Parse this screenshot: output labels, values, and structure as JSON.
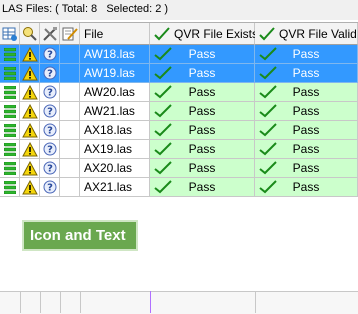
{
  "header": {
    "text": "LAS Files: ( Total: 8   Selected: 2 )"
  },
  "columns": {
    "file": "File",
    "qvr_exists": "QVR File Exists",
    "qvr_valid": "QVR File Valid"
  },
  "rows": [
    {
      "file": "AW18.las",
      "exists": "Pass",
      "valid": "Pass",
      "selected": true
    },
    {
      "file": "AW19.las",
      "exists": "Pass",
      "valid": "Pass",
      "selected": true
    },
    {
      "file": "AW20.las",
      "exists": "Pass",
      "valid": "Pass",
      "selected": false
    },
    {
      "file": "AW21.las",
      "exists": "Pass",
      "valid": "Pass",
      "selected": false
    },
    {
      "file": "AX18.las",
      "exists": "Pass",
      "valid": "Pass",
      "selected": false
    },
    {
      "file": "AX19.las",
      "exists": "Pass",
      "valid": "Pass",
      "selected": false
    },
    {
      "file": "AX20.las",
      "exists": "Pass",
      "valid": "Pass",
      "selected": false
    },
    {
      "file": "AX21.las",
      "exists": "Pass",
      "valid": "Pass",
      "selected": false
    }
  ],
  "header_icons": [
    "table-import-icon",
    "search-warning-icon",
    "tools-icon",
    "edit-note-icon"
  ],
  "row_icons": [
    "database-icon",
    "warning-icon",
    "help-icon"
  ],
  "callout": {
    "text": "Icon and Text"
  },
  "colors": {
    "selected": "#3399ff",
    "pass_bg": "#ccffcc",
    "check": "#1a8a1a",
    "warning": "#f5d60a",
    "database": "#2db52d",
    "callout": "#6aa84f"
  }
}
